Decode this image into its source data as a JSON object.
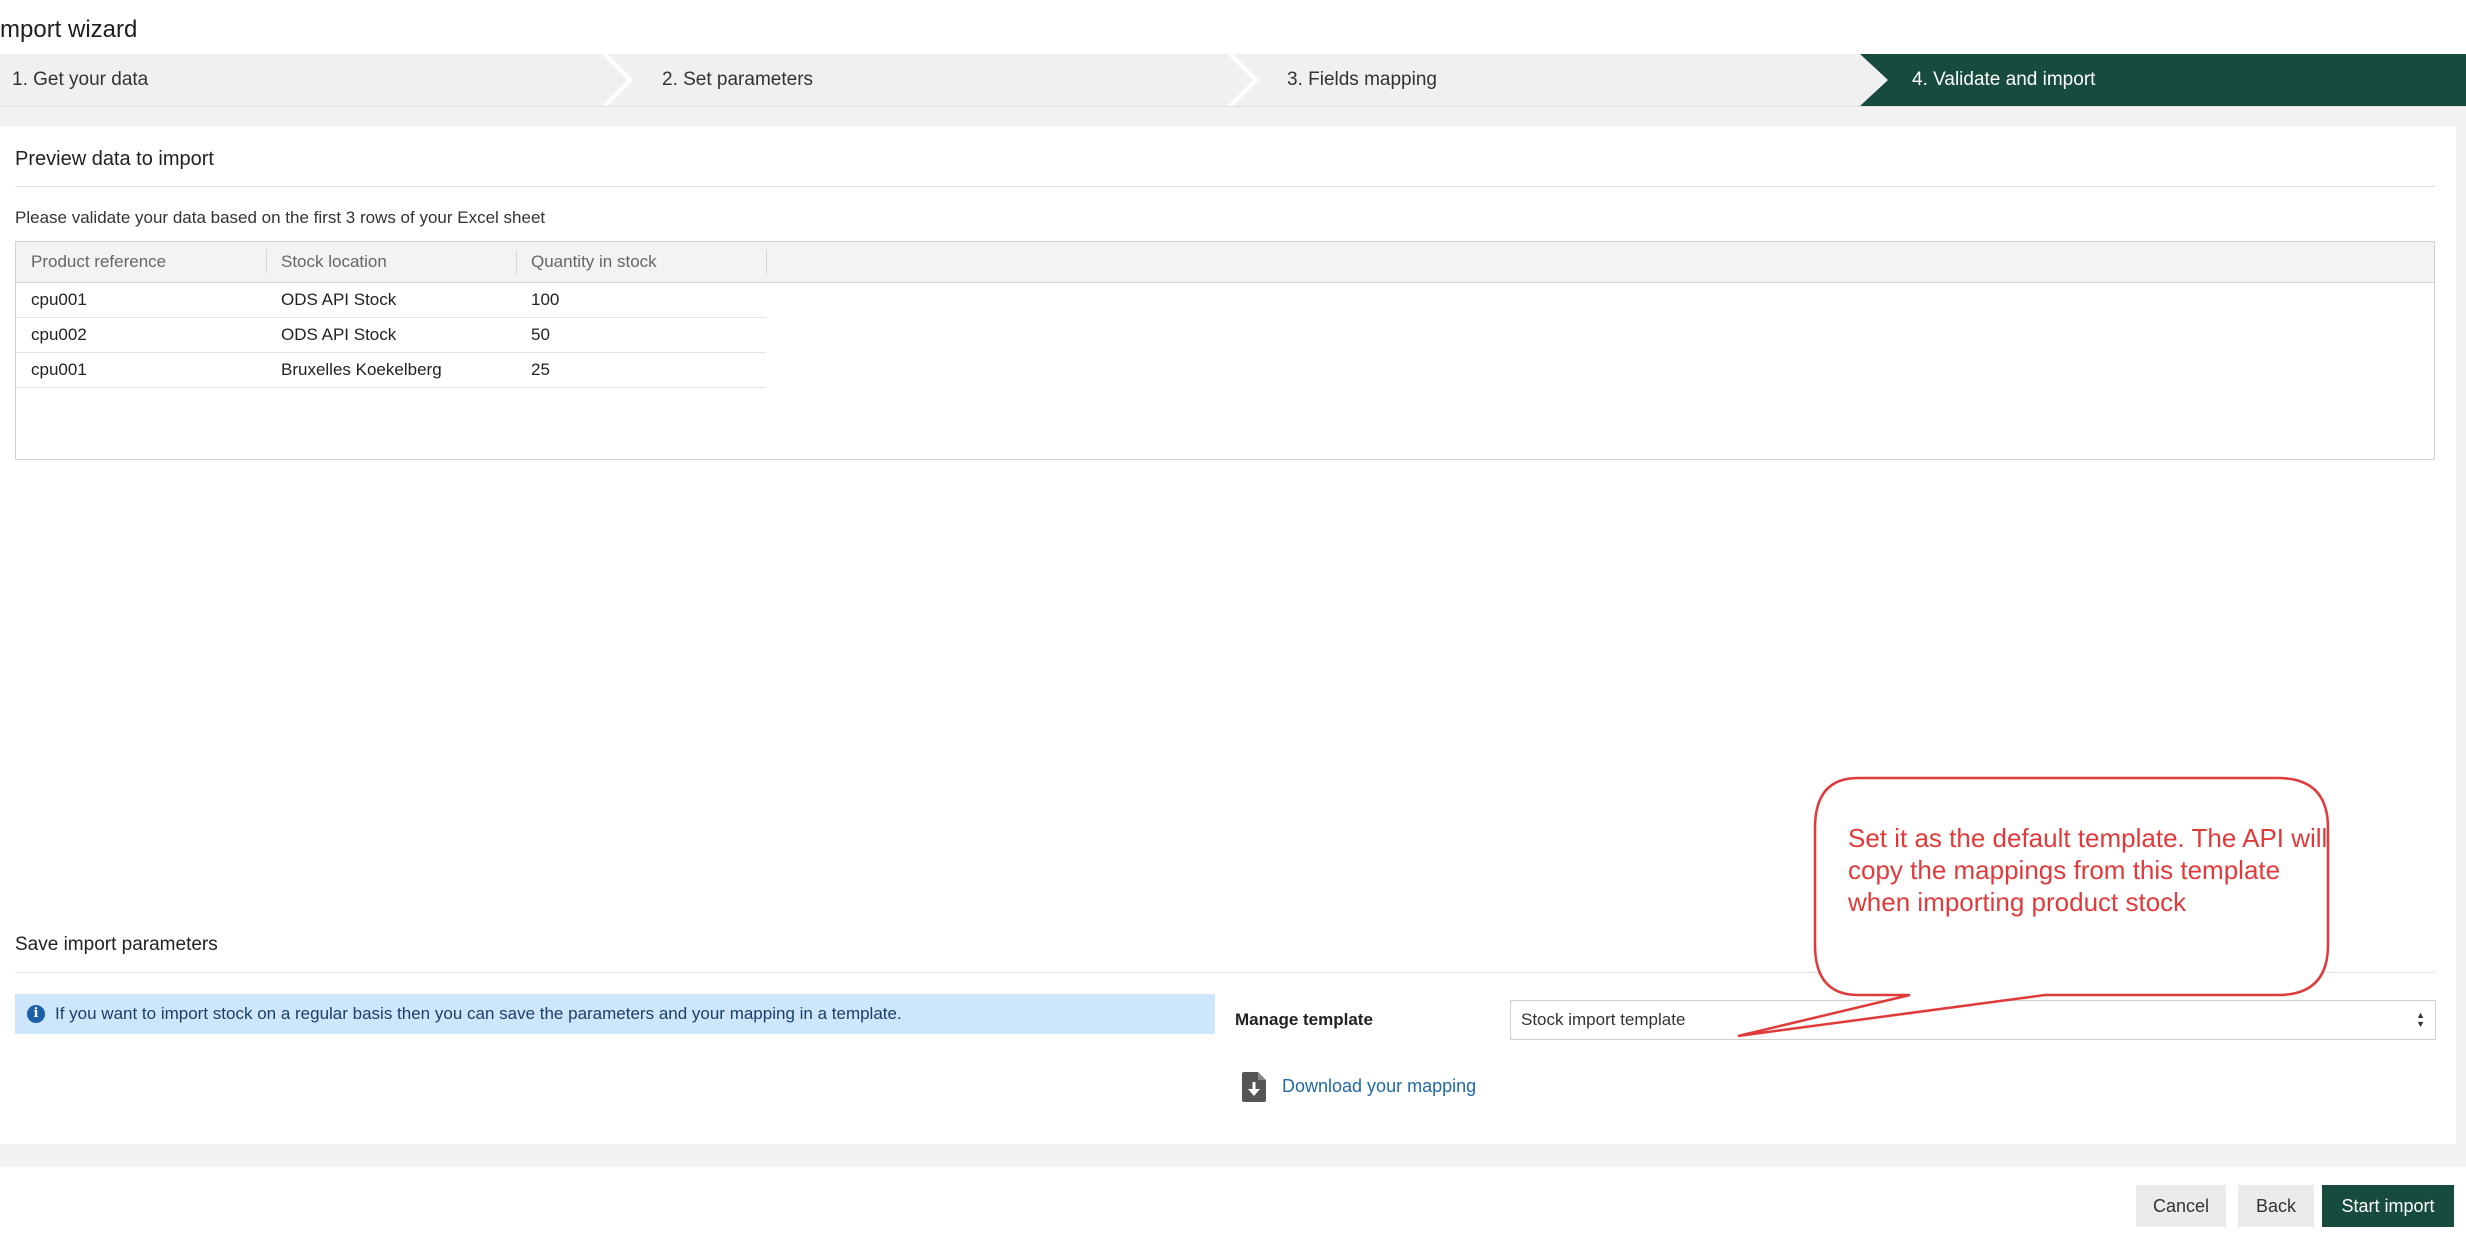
{
  "window": {
    "title": "mport wizard"
  },
  "steps": [
    {
      "label": "1. Get your data"
    },
    {
      "label": "2. Set parameters"
    },
    {
      "label": "3. Fields mapping"
    },
    {
      "label": "4. Validate and import"
    }
  ],
  "preview": {
    "title": "Preview data to import",
    "hint": "Please validate your data based on the first 3 rows of your Excel sheet",
    "columns": [
      "Product reference",
      "Stock location",
      "Quantity in stock"
    ],
    "rows": [
      [
        "cpu001",
        "ODS API Stock",
        "100"
      ],
      [
        "cpu002",
        "ODS API Stock",
        "50"
      ],
      [
        "cpu001",
        "Bruxelles Koekelberg",
        "25"
      ]
    ]
  },
  "save_params": {
    "title": "Save import parameters",
    "info": "If you want to import stock on a regular basis then you can save the parameters and your mapping in a template.",
    "manage_label": "Manage template",
    "template_value": "Stock import template",
    "download_label": "Download your mapping"
  },
  "footer": {
    "cancel_label": "Cancel",
    "back_label": "Back",
    "start_label": "Start import"
  },
  "annotation": {
    "text": "Set it as the default template. The API will copy the mappings from this template when importing product stock",
    "color": "#e03a3a"
  },
  "colors": {
    "accent": "#164b3e",
    "info_bg": "#cde6fb",
    "link": "#1f6aa5"
  },
  "icons": {
    "info": "info-circle-icon",
    "download": "download-file-icon",
    "select": "select-arrows-icon"
  }
}
